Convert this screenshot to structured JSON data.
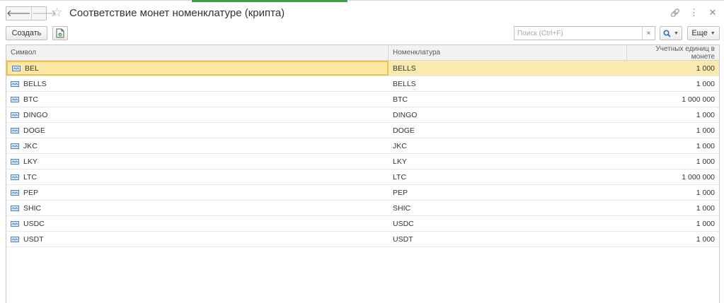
{
  "header": {
    "title": "Соответствие монет номенклатуре (крипта)",
    "back_glyph": "🡐",
    "forward_glyph": "🡒",
    "star_glyph": "☆",
    "link_glyph": "🔗",
    "menu_glyph": "⋮",
    "close_glyph": "✕"
  },
  "toolbar": {
    "create_label": "Создать",
    "search_placeholder": "Поиск (Ctrl+F)",
    "search_value": "",
    "clear_glyph": "×",
    "find_glyph": "🔍",
    "more_label": "Еще"
  },
  "table": {
    "columns": [
      "Символ",
      "Номенклатура",
      "Учетных единиц в монете"
    ],
    "rows": [
      {
        "symbol": "BEL",
        "nomenclature": "BELLS",
        "units": "1 000",
        "selected": true
      },
      {
        "symbol": "BELLS",
        "nomenclature": "BELLS",
        "units": "1 000"
      },
      {
        "symbol": "BTC",
        "nomenclature": "BTC",
        "units": "1 000 000"
      },
      {
        "symbol": "DINGO",
        "nomenclature": "DINGO",
        "units": "1 000"
      },
      {
        "symbol": "DOGE",
        "nomenclature": "DOGE",
        "units": "1 000"
      },
      {
        "symbol": "JKC",
        "nomenclature": "JKC",
        "units": "1 000"
      },
      {
        "symbol": "LKY",
        "nomenclature": "LKY",
        "units": "1 000"
      },
      {
        "symbol": "LTC",
        "nomenclature": "LTC",
        "units": "1 000 000"
      },
      {
        "symbol": "PEP",
        "nomenclature": "PEP",
        "units": "1 000"
      },
      {
        "symbol": "SHIC",
        "nomenclature": "SHIC",
        "units": "1 000"
      },
      {
        "symbol": "USDC",
        "nomenclature": "USDC",
        "units": "1 000"
      },
      {
        "symbol": "USDT",
        "nomenclature": "USDT",
        "units": "1 000"
      }
    ]
  },
  "colors": {
    "selected_row": "#fbeab0",
    "selected_cell_border": "#f2c14b",
    "active_tab_strip": "#3aa34a"
  }
}
